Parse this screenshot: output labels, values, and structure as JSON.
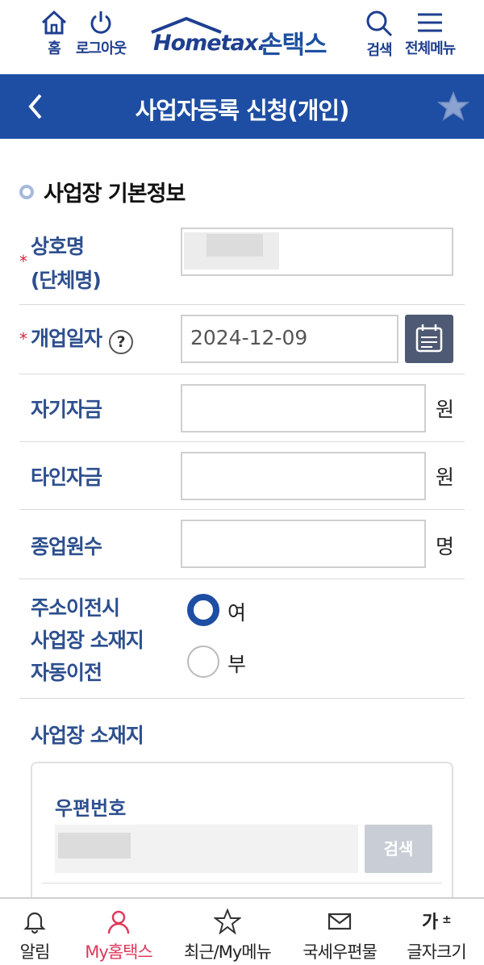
{
  "header": {
    "home_label": "홈",
    "logout_label": "로그아웃",
    "logo_text_en": "Hometax.",
    "logo_text_kr": "손택스",
    "search_label": "검색",
    "menu_label": "전체메뉴"
  },
  "titlebar": {
    "title": "사업자등록 신청(개인)"
  },
  "section": {
    "title": "사업장 기본정보"
  },
  "form": {
    "trade_name_label_1": "상호명",
    "trade_name_label_2": "(단체명)",
    "open_date_label": "개업일자",
    "open_date_help": "?",
    "open_date_value": "2024-12-09",
    "own_capital_label": "자기자금",
    "own_capital_unit": "원",
    "other_capital_label": "타인자금",
    "other_capital_unit": "원",
    "employees_label": "종업원수",
    "employees_unit": "명",
    "auto_move_label_1": "주소이전시",
    "auto_move_label_2": "사업장 소재지",
    "auto_move_label_3": "자동이전",
    "auto_move_options": [
      "여",
      "부"
    ],
    "auto_move_selected": "여",
    "location_label": "사업장 소재지",
    "postcode_label": "우편번호",
    "postcode_search_button": "검색"
  },
  "bottom_nav": {
    "items": [
      {
        "label": "알림",
        "icon": "bell-icon"
      },
      {
        "label": "My홈택스",
        "icon": "person-icon",
        "active": true
      },
      {
        "label": "최근/My메뉴",
        "icon": "star-icon"
      },
      {
        "label": "국세우편물",
        "icon": "mail-icon"
      },
      {
        "label": "글자크기",
        "icon": "font-size-icon"
      }
    ]
  },
  "colors": {
    "primary": "#1e4ea3",
    "label_blue": "#2d4f8e",
    "required_red": "#d8263b",
    "active_nav": "#e0385b"
  }
}
